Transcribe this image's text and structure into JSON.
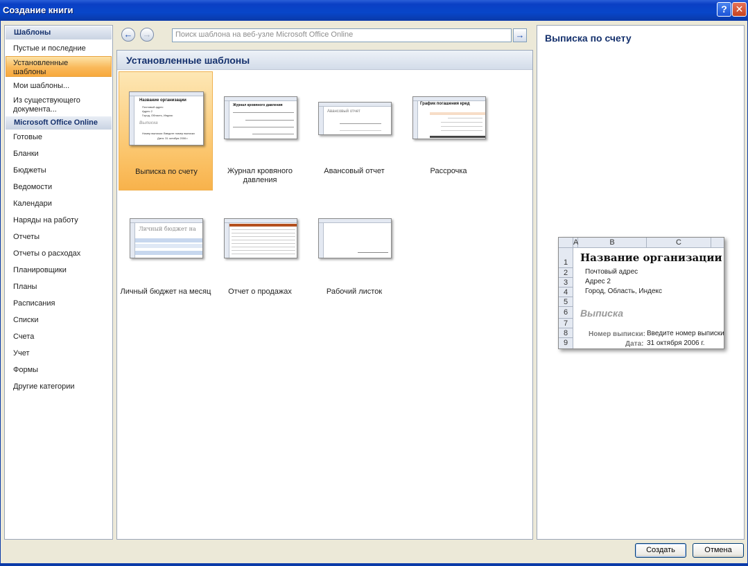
{
  "window": {
    "title": "Создание книги",
    "help_label": "?",
    "close_label": "✕"
  },
  "left_pane": {
    "header_templates": "Шаблоны",
    "items_top": [
      {
        "label": "Пустые и последние"
      },
      {
        "label": "Установленные шаблоны",
        "selected": true
      },
      {
        "label": "Мои шаблоны..."
      },
      {
        "label": "Из существующего документа..."
      }
    ],
    "header_online": "Microsoft Office Online",
    "items_online": [
      "Готовые",
      "Бланки",
      "Бюджеты",
      "Ведомости",
      "Календари",
      "Наряды на работу",
      "Отчеты",
      "Отчеты о расходах",
      "Планировщики",
      "Планы",
      "Расписания",
      "Списки",
      "Счета",
      "Учет",
      "Формы",
      "Другие категории"
    ]
  },
  "navigation": {
    "back_icon": "back-arrow-icon",
    "forward_icon": "forward-arrow-icon",
    "search_placeholder": "Поиск шаблона на веб-узле Microsoft Office Online",
    "go_icon": "go-arrow-icon"
  },
  "center_pane": {
    "title": "Установленные шаблоны",
    "templates": [
      {
        "label": "Выписка по счету",
        "selected": true
      },
      {
        "label": "Журнал кровяного давления"
      },
      {
        "label": "Авансовый отчет"
      },
      {
        "label": "Рассрочка"
      },
      {
        "label": "Личный бюджет на месяц"
      },
      {
        "label": "Отчет о продажах"
      },
      {
        "label": "Рабочий листок"
      }
    ],
    "thumb_texts": {
      "t1_title": "Название организации",
      "t1_l1": "Почтовый адрес",
      "t1_l2": "Адрес 2",
      "t1_l3": "Город, Область, Индекс",
      "t1_l4": "Выписка",
      "t1_l5": "Номер выписки:  Введите номер выписки",
      "t1_l6": "Дата:  31 октября 2006 г.",
      "t2_title": "Журнал кровяного давления",
      "t3_title": "Авансовый отчет",
      "t4_title": "График погашения кред",
      "t5_title": "Личный бюджет на"
    }
  },
  "right_pane": {
    "title": "Выписка по счету",
    "preview": {
      "columns": [
        "A",
        "B",
        "C"
      ],
      "rows": [
        "1",
        "2",
        "3",
        "4",
        "5",
        "6",
        "7",
        "8",
        "9"
      ],
      "org_name": "Название организации",
      "address1": "Почтовый адрес",
      "address2": "Адрес 2",
      "city": "Город, Область, Индекс",
      "doc_title": "Выписка",
      "number_label": "Номер выписки:",
      "number_value": "Введите номер выписки",
      "date_label": "Дата:",
      "date_value": "31 октября 2006 г."
    }
  },
  "buttons": {
    "create": "Создать",
    "cancel": "Отмена"
  }
}
